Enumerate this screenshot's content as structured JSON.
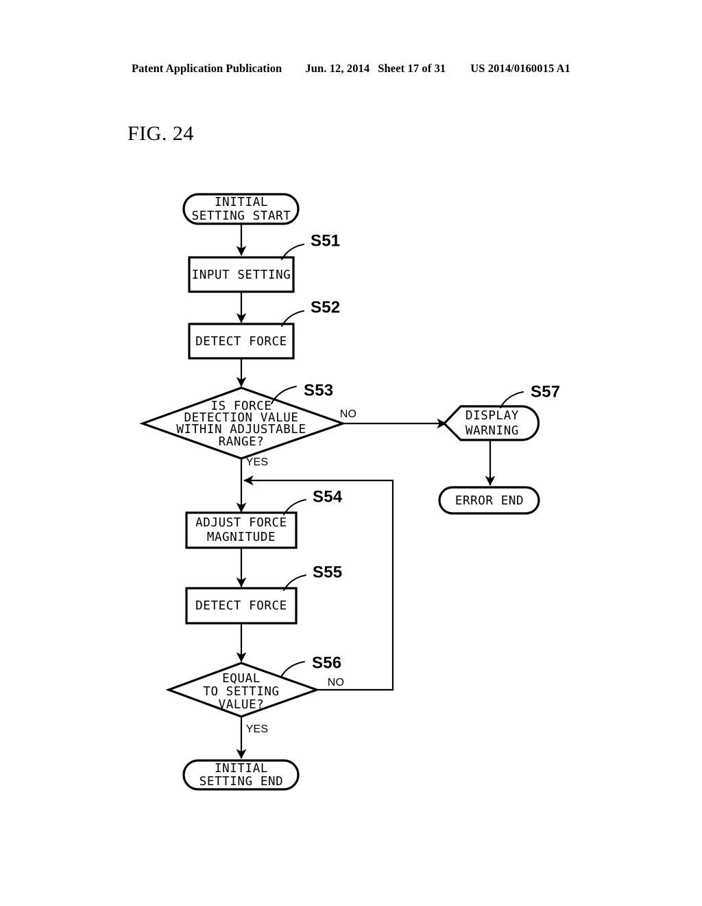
{
  "header": {
    "publication": "Patent Application Publication",
    "date": "Jun. 12, 2014",
    "sheet": "Sheet 17 of 31",
    "patent_number": "US 2014/0160015 A1"
  },
  "figure": {
    "label": "FIG. 24"
  },
  "flowchart": {
    "nodes": {
      "start": {
        "shape": "terminator",
        "line1": "INITIAL",
        "line2": "SETTING START"
      },
      "s51": {
        "shape": "process",
        "step": "S51",
        "line1": "INPUT SETTING"
      },
      "s52": {
        "shape": "process",
        "step": "S52",
        "line1": "DETECT FORCE"
      },
      "s53": {
        "shape": "decision",
        "step": "S53",
        "line1": "IS FORCE",
        "line2": "DETECTION VALUE",
        "line3": "WITHIN ADJUSTABLE",
        "line4": "RANGE?",
        "yes": "YES",
        "no": "NO"
      },
      "s57": {
        "shape": "display",
        "step": "S57",
        "line1": "DISPLAY",
        "line2": "WARNING"
      },
      "error_end": {
        "shape": "terminator",
        "line1": "ERROR END"
      },
      "s54": {
        "shape": "process",
        "step": "S54",
        "line1": "ADJUST FORCE",
        "line2": "MAGNITUDE"
      },
      "s55": {
        "shape": "process",
        "step": "S55",
        "line1": "DETECT FORCE"
      },
      "s56": {
        "shape": "decision",
        "step": "S56",
        "line1": "EQUAL",
        "line2": "TO SETTING",
        "line3": "VALUE?",
        "yes": "YES",
        "no": "NO"
      },
      "end": {
        "shape": "terminator",
        "line1": "INITIAL",
        "line2": "SETTING END"
      }
    },
    "colors": {
      "stroke": "#000000",
      "fill": "#ffffff",
      "background": "#ffffff"
    }
  }
}
